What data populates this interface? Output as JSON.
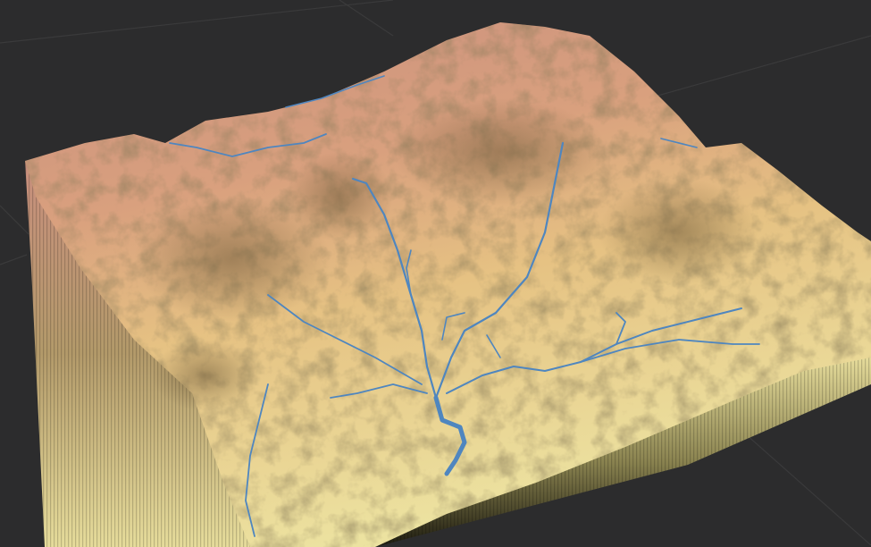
{
  "scene": {
    "background_color": "#2c2c2d",
    "grid_line_color": "#3a3a3b",
    "terrain_high_color": "#c98f7e",
    "terrain_mid_color": "#e3b27c",
    "terrain_low_color": "#ece2a0",
    "river_color": "#4f86bf",
    "cliff_dark_color": "#2a2412"
  }
}
